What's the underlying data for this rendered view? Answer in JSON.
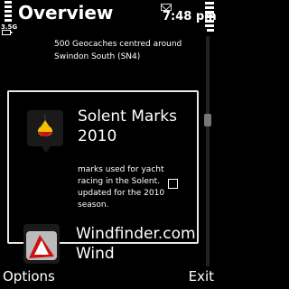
{
  "status": {
    "title": "Overview",
    "network": "3.5G",
    "clock": "7:48 pm"
  },
  "list": {
    "previous_description": "500 Geocaches centred around Swindon South (SN4)",
    "selected": {
      "title": "Solent Marks 2010",
      "description": "marks used for yacht racing in the Solent. updated for the 2010 season.",
      "checked": false
    },
    "next": {
      "title": "Windfinder.com Wind"
    }
  },
  "softkeys": {
    "left": "Options",
    "right": "Exit"
  },
  "colors": {
    "background": "#000000",
    "text": "#ffffff",
    "selection_border": "#e8e8e8",
    "buoy_yellow": "#f2c200",
    "buoy_red": "#cc1111"
  }
}
